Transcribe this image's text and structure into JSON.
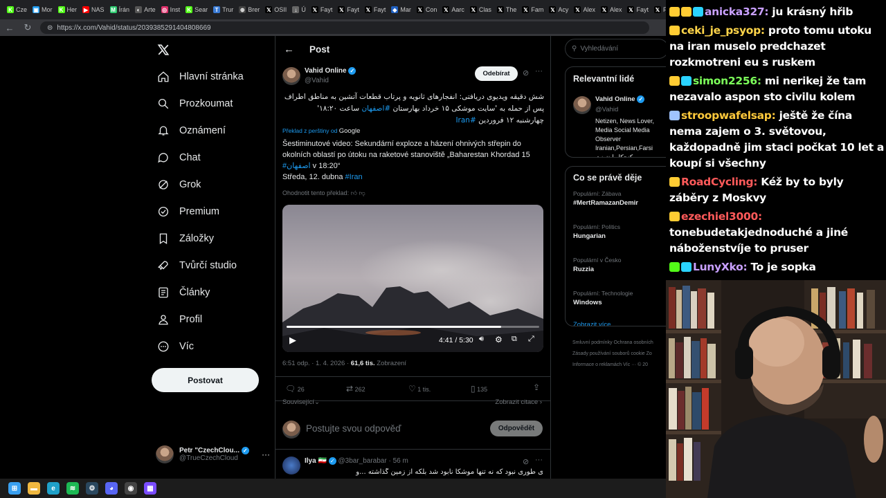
{
  "browser": {
    "tabs": [
      {
        "icon": "K",
        "color": "#53fc18",
        "label": "Cze"
      },
      {
        "icon": "▣",
        "color": "#1d9bf0",
        "label": "Mor"
      },
      {
        "icon": "K",
        "color": "#53fc18",
        "label": "Her"
      },
      {
        "icon": "▶",
        "color": "#ff0000",
        "label": "NAS"
      },
      {
        "icon": "M",
        "color": "#2ecc71",
        "label": "Írán"
      },
      {
        "icon": "◐",
        "color": "#555",
        "label": "Arte"
      },
      {
        "icon": "◎",
        "color": "#e1306c",
        "label": "Inst"
      },
      {
        "icon": "K",
        "color": "#53fc18",
        "label": "Sear"
      },
      {
        "icon": "T",
        "color": "#3a7bd5",
        "label": "Trur"
      },
      {
        "icon": "⊕",
        "color": "#444",
        "label": "Brer"
      },
      {
        "icon": "𝕏",
        "color": "#000",
        "label": "OSII"
      },
      {
        "icon": "↓",
        "color": "#666",
        "label": "Ú"
      },
      {
        "icon": "𝕏",
        "color": "#000",
        "label": "Fayt"
      },
      {
        "icon": "𝕏",
        "color": "#000",
        "label": "Fayt"
      },
      {
        "icon": "𝕏",
        "color": "#000",
        "label": "Fayt"
      },
      {
        "icon": "◆",
        "color": "#1f5fbf",
        "label": "Mar"
      },
      {
        "icon": "𝕏",
        "color": "#000",
        "label": "Con"
      },
      {
        "icon": "𝕏",
        "color": "#000",
        "label": "Aarc"
      },
      {
        "icon": "𝕏",
        "color": "#000",
        "label": "Clas"
      },
      {
        "icon": "𝕏",
        "color": "#000",
        "label": "The"
      },
      {
        "icon": "𝕏",
        "color": "#000",
        "label": "Fam"
      },
      {
        "icon": "𝕏",
        "color": "#000",
        "label": "Acy"
      },
      {
        "icon": "𝕏",
        "color": "#000",
        "label": "Alex"
      },
      {
        "icon": "𝕏",
        "color": "#000",
        "label": "Alex"
      },
      {
        "icon": "𝕏",
        "color": "#000",
        "label": "Fayt"
      },
      {
        "icon": "𝕏",
        "color": "#000",
        "label": "Fayt"
      }
    ],
    "url": "https://x.com/Vahid/status/2039385291404808669"
  },
  "nav": {
    "items": [
      {
        "label": "Hlavní stránka",
        "icon": "home-icon"
      },
      {
        "label": "Prozkoumat",
        "icon": "search-icon"
      },
      {
        "label": "Oznámení",
        "icon": "bell-icon"
      },
      {
        "label": "Chat",
        "icon": "chat-icon"
      },
      {
        "label": "Grok",
        "icon": "grok-icon"
      },
      {
        "label": "Premium",
        "icon": "premium-icon"
      },
      {
        "label": "Záložky",
        "icon": "bookmark-icon"
      },
      {
        "label": "Tvůrčí studio",
        "icon": "rocket-icon"
      },
      {
        "label": "Články",
        "icon": "article-icon"
      },
      {
        "label": "Profil",
        "icon": "profile-icon"
      },
      {
        "label": "Víc",
        "icon": "more-icon"
      }
    ],
    "post_button": "Postovat",
    "account": {
      "name": "Petr \"CzechClou...",
      "handle": "@TrueCzechCloud"
    }
  },
  "post": {
    "header": "Post",
    "author": {
      "name": "Vahid Online",
      "handle": "@Vahid"
    },
    "follow": "Odebírat",
    "persian_text": "شش دقیقه ویدیوی دریافتی: انفجارهای ثانویه و پرتاب قطعات آتشین به مناطق اطراف پس از حمله به 'سایت موشکی ۱۵ خرداد بهارستان",
    "persian_tag1": "#اصفهان",
    "persian_time": "ساعت ۱۸:۲۰'",
    "persian_line3": "چهارشنبه ۱۲ فروردین",
    "persian_tag2": "#Iran",
    "translated_by": "Překlad z perštiny od",
    "translator": "Google",
    "translation_line1": "Šestiminutové video: Sekundární exploze a házení ohnivých střepin do okolních oblastí po útoku na raketové stanoviště „Baharestan Khordad 15",
    "translation_tag": "#اصفهان",
    "translation_time": " v 18:20“",
    "translation_day": "Středa, 12. dubna ",
    "translation_tag2": "#Iran",
    "rate": "Ohodnotit tento překlad:",
    "video": {
      "time": "4:41 / 5:30",
      "progress": 0.85
    },
    "meta_time": "6:51 odp. · 1. 4. 2026 · ",
    "views_count": "61,6 tis.",
    "views_label": "Zobrazení",
    "stats": {
      "replies": "26",
      "reposts": "262",
      "likes": "1 tis.",
      "bookmarks": "135"
    },
    "related": "Související",
    "quotes": "Zobrazit citace",
    "reply_placeholder": "Postujte svou odpověď",
    "reply_button": "Odpovědět",
    "next_reply": {
      "name": "Ilya",
      "flag": "🇮🇷",
      "handle": "@3bar_barabar",
      "time": "· 56 m",
      "text": "ی طوری نبود که نه تنها موشکا نابود شد بلکه از زمین گذاشته ...و"
    }
  },
  "sidebar": {
    "search_placeholder": "Vyhledávání",
    "relevant_title": "Relevantní lidé",
    "person": {
      "name": "Vahid Online",
      "handle": "@Vahid",
      "bio": "Netizen, News Lover, Media Social Media Observer Iranian,Persian,Farsi کنجکاو اینترنت"
    },
    "trends_title": "Co se právě děje",
    "trends": [
      {
        "cat": "Populární: Zábava",
        "name": "#MertRamazanDemir"
      },
      {
        "cat": "Populární: Politics",
        "name": "Hungarian"
      },
      {
        "cat": "Populární v Česko",
        "name": "Ruzzia"
      },
      {
        "cat": "Populární: Technologie",
        "name": "Windows"
      }
    ],
    "show_more": "Zobrazit více",
    "footer1": "Smluvní podmínky    Ochrana osobních",
    "footer2": "Zásady používání souborů cookie    Zo",
    "footer3": "Informace o reklamách    Víc ···    © 20"
  },
  "chat": [
    {
      "user": "anicka327",
      "color": "#c9a0ff",
      "badges": [
        "#ffcc33",
        "#ffcc33",
        "#2ad3ff"
      ],
      "text": "ju krásný hřib"
    },
    {
      "user": "ceki_je_psyop",
      "color": "#ffd54a",
      "badges": [
        "#ffcc33"
      ],
      "text": "proto tomu utoku na iran muselo predchazet rozkmotreni eu s ruskem"
    },
    {
      "user": "simon2256",
      "color": "#7cff5a",
      "badges": [
        "#ffcc33",
        "#2ad3ff"
      ],
      "text": "mi nerikej že tam nezavalo aspon sto civilu kolem"
    },
    {
      "user": "stroopwafelsap",
      "color": "#ffc93b",
      "badges": [
        "#9fc3ff"
      ],
      "text": "ještě že čína nema zajem o 3. světovou, každopadně jim staci počkat 10 let a koupí si všechny"
    },
    {
      "user": "RoadCycling",
      "color": "#ff5a5a",
      "badges": [
        "#ffcc33"
      ],
      "text": "Kéž by to byly záběry z Moskvy"
    },
    {
      "user": "ezechiel3000",
      "color": "#ff5a5a",
      "badges": [
        "#ffcc33"
      ],
      "text": "tonebudetakjednoduché a jiné náboženstvíje to pruser"
    },
    {
      "user": "LunyXko",
      "color": "#c9a0ff",
      "badges": [
        "#53fc18",
        "#2ad3ff"
      ],
      "text": "To je sopka"
    }
  ],
  "taskbar": [
    "windows-icon",
    "folder-icon",
    "edge-icon",
    "spotify-icon",
    "steam-icon",
    "discord-icon",
    "obs-icon",
    "app-icon"
  ]
}
